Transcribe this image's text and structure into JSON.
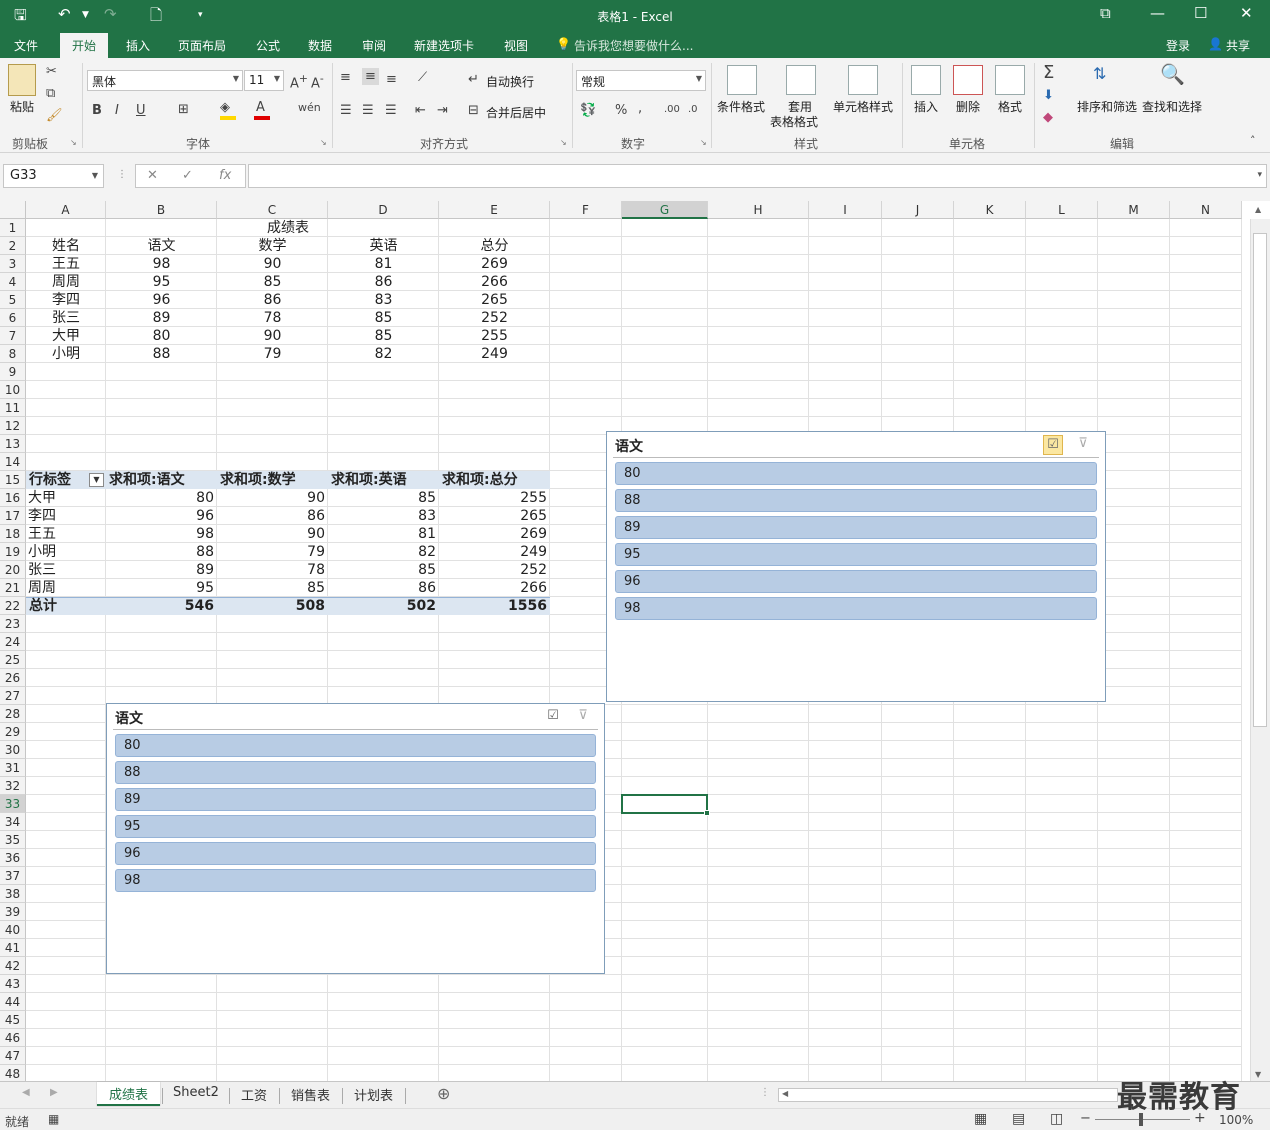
{
  "window": {
    "title": "表格1 - Excel"
  },
  "menu": {
    "tabs": [
      "文件",
      "开始",
      "插入",
      "页面布局",
      "公式",
      "数据",
      "审阅",
      "新建选项卡",
      "视图"
    ],
    "active": "开始",
    "tell_me": "告诉我您想要做什么...",
    "login": "登录",
    "share": "共享"
  },
  "ribbon": {
    "clipboard": {
      "paste": "粘贴",
      "label": "剪贴板"
    },
    "font": {
      "name": "黑体",
      "size": "11",
      "label": "字体",
      "bold": "B",
      "italic": "I",
      "underline": "U"
    },
    "alignment": {
      "wrap": "自动换行",
      "merge": "合并后居中",
      "label": "对齐方式"
    },
    "number": {
      "format": "常规",
      "label": "数字"
    },
    "styles": {
      "conditional": "条件格式",
      "table_line1": "套用",
      "table_line2": "表格格式",
      "cell_styles": "单元格样式",
      "label": "样式"
    },
    "cells": {
      "insert": "插入",
      "delete": "删除",
      "format": "格式",
      "label": "单元格"
    },
    "editing": {
      "sort": "排序和筛选",
      "find": "查找和选择",
      "label": "编辑"
    }
  },
  "formula_bar": {
    "name_box": "G33",
    "formula": ""
  },
  "columns": [
    "A",
    "B",
    "C",
    "D",
    "E",
    "F",
    "G",
    "H",
    "I",
    "J",
    "K",
    "L",
    "M",
    "N"
  ],
  "selected_column": "G",
  "selected_row": "33",
  "sheet": {
    "title": "成绩表",
    "headers": [
      "姓名",
      "语文",
      "数学",
      "英语",
      "总分"
    ],
    "rows": [
      [
        "王五",
        "98",
        "90",
        "81",
        "269"
      ],
      [
        "周周",
        "95",
        "85",
        "86",
        "266"
      ],
      [
        "李四",
        "96",
        "86",
        "83",
        "265"
      ],
      [
        "张三",
        "89",
        "78",
        "85",
        "252"
      ],
      [
        "大甲",
        "80",
        "90",
        "85",
        "255"
      ],
      [
        "小明",
        "88",
        "79",
        "82",
        "249"
      ]
    ]
  },
  "pivot": {
    "headers": [
      "行标签",
      "求和项:语文",
      "求和项:数学",
      "求和项:英语",
      "求和项:总分"
    ],
    "rows": [
      [
        "大甲",
        "80",
        "90",
        "85",
        "255"
      ],
      [
        "李四",
        "96",
        "86",
        "83",
        "265"
      ],
      [
        "王五",
        "98",
        "90",
        "81",
        "269"
      ],
      [
        "小明",
        "88",
        "79",
        "82",
        "249"
      ],
      [
        "张三",
        "89",
        "78",
        "85",
        "252"
      ],
      [
        "周周",
        "95",
        "85",
        "86",
        "266"
      ]
    ],
    "total": [
      "总计",
      "546",
      "508",
      "502",
      "1556"
    ]
  },
  "slicers": [
    {
      "title": "语文",
      "items": [
        "80",
        "88",
        "89",
        "95",
        "96",
        "98"
      ],
      "multiselect_active": true
    },
    {
      "title": "语文",
      "items": [
        "80",
        "88",
        "89",
        "95",
        "96",
        "98"
      ],
      "multiselect_active": false
    }
  ],
  "sheet_tabs": [
    "成绩表",
    "Sheet2",
    "工资",
    "销售表",
    "计划表"
  ],
  "active_sheet": "成绩表",
  "status": {
    "ready": "就绪",
    "zoom": "100%"
  },
  "watermark": "最需教育",
  "colors": {
    "excel_green": "#217346",
    "pivot_header": "#dce6f1",
    "slicer_item": "#b8cce4"
  }
}
